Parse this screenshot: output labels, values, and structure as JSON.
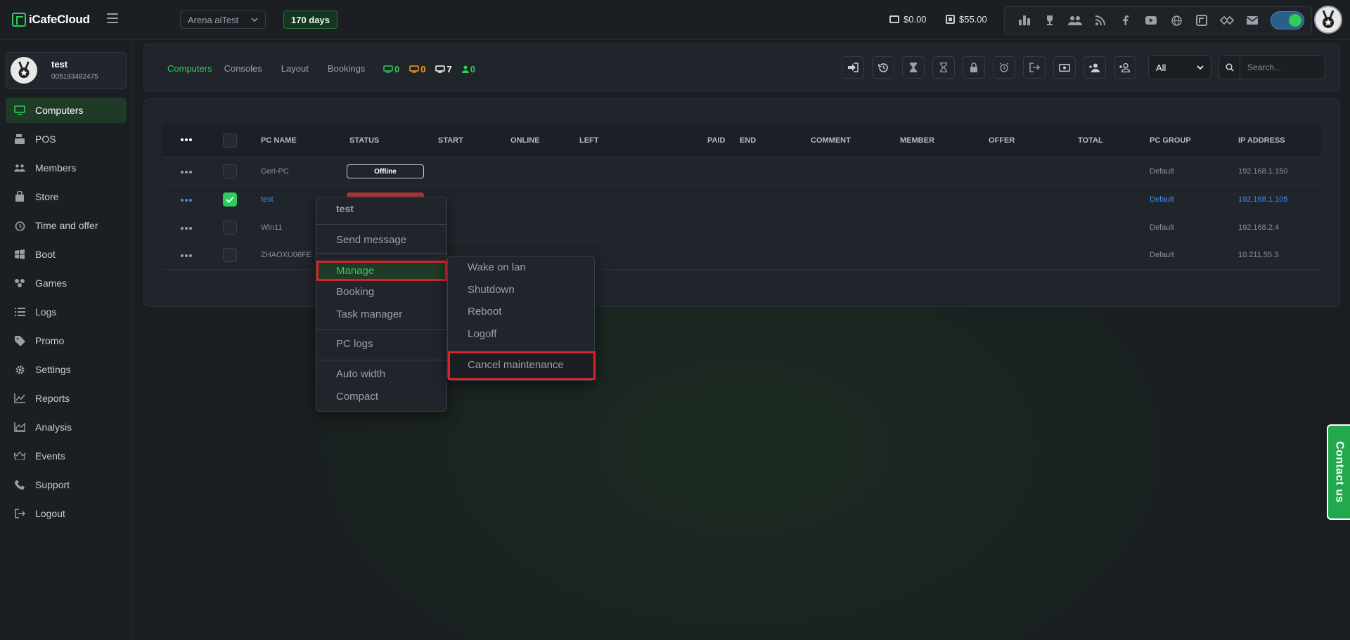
{
  "app": {
    "name": "iCafeCloud"
  },
  "header": {
    "cafe_select": "Arena aiTest",
    "days_badge": "170 days",
    "cash_balance": "$0.00",
    "qr_balance": "$55.00",
    "icons": [
      "leaderboard-icon",
      "trophy-icon",
      "group-icon",
      "rss-icon",
      "facebook-icon",
      "youtube-icon",
      "globe-icon",
      "icafe-icon",
      "handshake-icon",
      "mail-icon"
    ],
    "toggle_on": true
  },
  "profile": {
    "name": "test",
    "id": "005193482475"
  },
  "sidebar": {
    "items": [
      {
        "label": "Computers",
        "icon": "monitor-icon",
        "active": true
      },
      {
        "label": "POS",
        "icon": "register-icon"
      },
      {
        "label": "Members",
        "icon": "members-icon"
      },
      {
        "label": "Store",
        "icon": "bag-icon"
      },
      {
        "label": "Time and offer",
        "icon": "clock-icon"
      },
      {
        "label": "Boot",
        "icon": "windows-icon"
      },
      {
        "label": "Games",
        "icon": "gamepad-icon"
      },
      {
        "label": "Logs",
        "icon": "list-icon"
      },
      {
        "label": "Promo",
        "icon": "tag-icon"
      },
      {
        "label": "Settings",
        "icon": "gear-icon"
      },
      {
        "label": "Reports",
        "icon": "line-chart-icon"
      },
      {
        "label": "Analysis",
        "icon": "area-chart-icon"
      },
      {
        "label": "Events",
        "icon": "crown-icon"
      },
      {
        "label": "Support",
        "icon": "phone-icon"
      },
      {
        "label": "Logout",
        "icon": "logout-icon"
      }
    ]
  },
  "toolbar": {
    "tabs": [
      "Computers",
      "Consoles",
      "Layout",
      "Bookings"
    ],
    "counts": {
      "green": "0",
      "orange": "0",
      "white": "7",
      "members": "0"
    },
    "group_select": "All",
    "search_placeholder": "Search..."
  },
  "table": {
    "columns": [
      "PC NAME",
      "STATUS",
      "START",
      "ONLINE",
      "LEFT",
      "PAID",
      "END",
      "COMMENT",
      "MEMBER",
      "OFFER",
      "TOTAL",
      "PC GROUP",
      "IP ADDRESS"
    ],
    "rows": [
      {
        "pc_name": "Geri-PC",
        "status": "Offline",
        "group": "Default",
        "ip": "192.168.1.150"
      },
      {
        "pc_name": "test",
        "status": "",
        "group": "Default",
        "ip": "192.168.1.105"
      },
      {
        "pc_name": "Win11",
        "status": "",
        "group": "Default",
        "ip": "192.168.2.4"
      },
      {
        "pc_name": "ZHAOXU06FE",
        "status": "",
        "group": "Default",
        "ip": "10.211.55.3"
      }
    ]
  },
  "context_menu": {
    "title": "test",
    "send_message": "Send message",
    "manage": "Manage",
    "booking": "Booking",
    "task_manager": "Task manager",
    "pc_logs": "PC logs",
    "auto_width": "Auto width",
    "compact": "Compact"
  },
  "submenu": {
    "wake_on_lan": "Wake on lan",
    "shutdown": "Shutdown",
    "reboot": "Reboot",
    "logoff": "Logoff",
    "cancel_maintenance": "Cancel maintenance"
  },
  "contact": {
    "label": "Contact us"
  },
  "colors": {
    "accent": "#2ecc5a",
    "highlight_border": "#d9232b",
    "link": "#3b8ef0",
    "orange": "#f0a020"
  }
}
